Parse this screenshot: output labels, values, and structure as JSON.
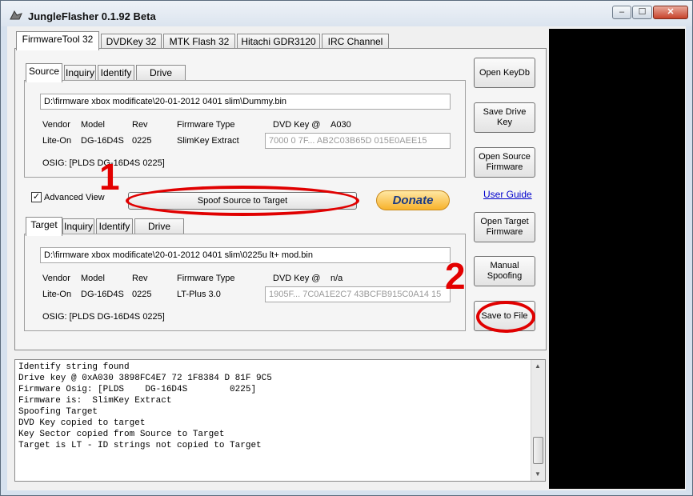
{
  "window": {
    "title": "JungleFlasher 0.1.92 Beta",
    "minimize": "–",
    "maximize": "☐",
    "close": "✕"
  },
  "main_tabs": [
    "FirmwareTool 32",
    "DVDKey 32",
    "MTK Flash 32",
    "Hitachi GDR3120",
    "IRC Channel"
  ],
  "source": {
    "tabs": [
      "Source",
      "Inquiry",
      "Identify",
      "Drive Serial"
    ],
    "path": "D:\\firmware xbox modificate\\20-01-2012 0401 slim\\Dummy.bin",
    "headers": {
      "vendor": "Vendor",
      "model": "Model",
      "rev": "Rev",
      "firmware_type": "Firmware Type",
      "dvd_key": "DVD Key @"
    },
    "dvd_key_addr": "A030",
    "vendor": "Lite-On",
    "model": "DG-16D4S",
    "rev": "0225",
    "firmware_type": "SlimKey Extract",
    "dvd_key_value": "7000 0 7F... AB2C03B65D 015E0AEE15",
    "osig": "OSIG: [PLDS    DG-16D4S        0225]"
  },
  "middle": {
    "advanced_view_label": "Advanced View",
    "advanced_view_checked": "✓",
    "spoof_button": "Spoof Source to Target",
    "donate_button": "Donate"
  },
  "target": {
    "tabs": [
      "Target",
      "Inquiry",
      "Identify",
      "Drive Serial"
    ],
    "path": "D:\\firmware xbox modificate\\20-01-2012 0401 slim\\0225u lt+ mod.bin",
    "headers": {
      "vendor": "Vendor",
      "model": "Model",
      "rev": "Rev",
      "firmware_type": "Firmware Type",
      "dvd_key": "DVD Key @"
    },
    "dvd_key_addr": "n/a",
    "vendor": "Lite-On",
    "model": "DG-16D4S",
    "rev": "0225",
    "firmware_type": "LT-Plus 3.0",
    "dvd_key_value": "1905F... 7C0A1E2C7 43BCFB915C0A14 15",
    "osig": "OSIG: [PLDS    DG-16D4S        0225]"
  },
  "side_buttons": {
    "open_keydb": "Open  KeyDb",
    "save_drive_key": "Save Drive Key",
    "open_source_firmware": "Open Source Firmware",
    "user_guide": "User Guide",
    "open_target_firmware": "Open Target Firmware",
    "manual_spoofing": "Manual Spoofing",
    "save_to_file": "Save to File"
  },
  "annotations": {
    "one": "1",
    "two": "2"
  },
  "log_lines": [
    "Identify string found",
    "Drive key @ 0xA030 3898FC4E7 72 1F8384 D 81F 9C5 ",
    "Firmware Osig: [PLDS    DG-16D4S        0225]",
    "Firmware is:  SlimKey Extract",
    "Spoofing Target",
    "DVD Key copied to target",
    "Key Sector copied from Source to Target",
    "Target is LT - ID strings not copied to Target"
  ],
  "colors": {
    "annotation_red": "#e30000",
    "link_blue": "#0000cc",
    "donate_gold": "#f7b22b"
  }
}
